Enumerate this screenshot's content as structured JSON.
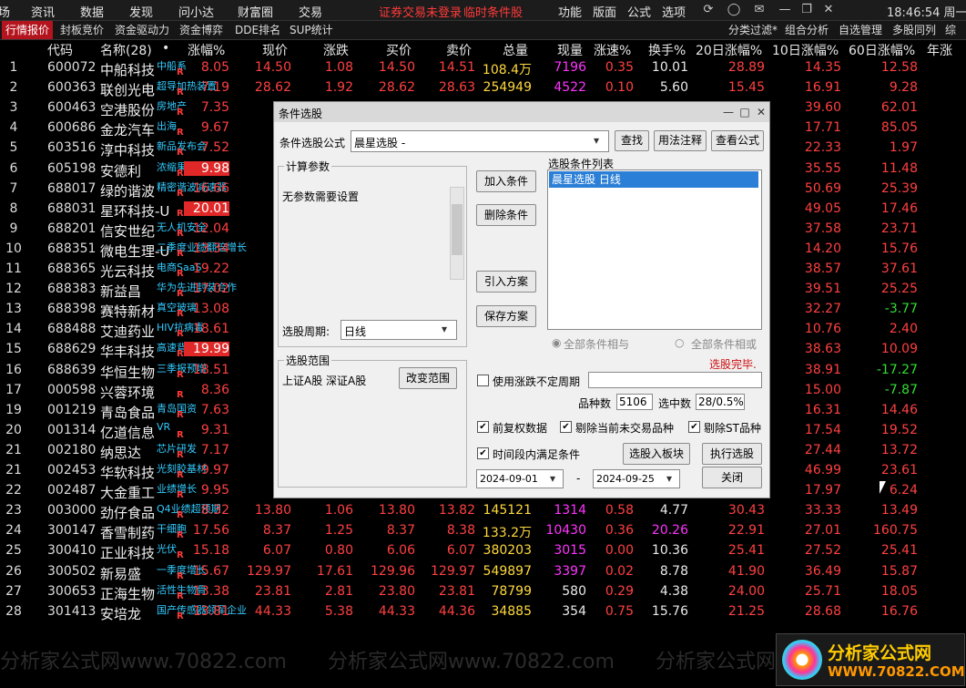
{
  "menu": {
    "items": [
      "场",
      "资讯",
      "数据",
      "发现",
      "问小达",
      "财富圈",
      "交易"
    ],
    "alert1": "证券交易未登录",
    "alert2": "临时条件股",
    "right_items": [
      "功能",
      "版面",
      "公式",
      "选项"
    ],
    "time": "18:46:54 周一"
  },
  "tabs": {
    "left": [
      "行情报价",
      "封板竞价",
      "资金驱动力",
      "资金博弈",
      "DDE排名",
      "SUP统计"
    ],
    "right": [
      "分类过滤*",
      "组合分析",
      "自选管理",
      "多股同列",
      "综"
    ]
  },
  "columns": [
    "代码",
    "名称(28)",
    "•",
    "涨幅%",
    "现价",
    "涨跌",
    "买价",
    "卖价",
    "总量",
    "现量",
    "涨速%",
    "换手%",
    "20日涨幅%",
    "10日涨幅%",
    "60日涨幅%",
    "年涨"
  ],
  "rows": [
    {
      "idx": "1",
      "code": "600072",
      "name": "中船科技",
      "tag": "中船系",
      "chg": "8.05",
      "price": "14.50",
      "diff": "1.08",
      "bid": "14.50",
      "ask": "14.51",
      "vol": "108.4万",
      "cur": "7196",
      "speed": "0.35",
      "turn": "10.01",
      "d20": "28.89",
      "d10": "14.35",
      "d60": "12.58"
    },
    {
      "idx": "2",
      "code": "600363",
      "name": "联创光电",
      "tag": "超导加热装置",
      "chg": "7.19",
      "price": "28.62",
      "diff": "1.92",
      "bid": "28.62",
      "ask": "28.63",
      "vol": "254949",
      "cur": "4522",
      "speed": "0.10",
      "turn": "5.60",
      "d20": "15.45",
      "d10": "16.91",
      "d60": "9.28"
    },
    {
      "idx": "3",
      "code": "600463",
      "name": "空港股份",
      "tag": "房地产",
      "chg": "7.35",
      "price": "12",
      "d10": "39.60",
      "d60": "62.01"
    },
    {
      "idx": "4",
      "code": "600686",
      "name": "金龙汽车",
      "tag": "出海",
      "chg": "9.67",
      "price": "13",
      "d10": "17.71",
      "d60": "85.05"
    },
    {
      "idx": "5",
      "code": "603516",
      "name": "淳中科技",
      "tag": "新品发布会",
      "chg": "7.52",
      "price": "31",
      "d10": "22.33",
      "d60": "1.97"
    },
    {
      "idx": "6",
      "code": "605198",
      "name": "安德利",
      "tag": "浓缩果汁",
      "chg": "9.98",
      "price": "23",
      "d10": "35.55",
      "d60": "11.48"
    },
    {
      "idx": "7",
      "code": "688017",
      "name": "绿的谐波",
      "tag": "精密谐波减速器",
      "chg": "16.66",
      "price": "88",
      "d10": "50.69",
      "d60": "25.39"
    },
    {
      "idx": "8",
      "code": "688031",
      "name": "星环科技-U",
      "tag": "",
      "chg": "20.01",
      "price": "39",
      "d10": "49.05",
      "d60": "17.46"
    },
    {
      "idx": "9",
      "code": "688201",
      "name": "信安世纪",
      "tag": "无人机安全",
      "chg": "12.04",
      "price": "15",
      "d10": "37.58",
      "d60": "23.71"
    },
    {
      "idx": "10",
      "code": "688351",
      "name": "微电生理-U",
      "tag": "二季度业绩翻倍增长",
      "chg": "13.34",
      "price": "21",
      "d10": "14.20",
      "d60": "15.76"
    },
    {
      "idx": "11",
      "code": "688365",
      "name": "光云科技",
      "tag": "电商SaaS",
      "chg": "19.22",
      "price": "11",
      "d10": "38.57",
      "d60": "37.61"
    },
    {
      "idx": "12",
      "code": "688383",
      "name": "新益昌",
      "tag": "华为先进封装合作",
      "chg": "17.02",
      "price": "57",
      "d10": "39.51",
      "d60": "25.25"
    },
    {
      "idx": "13",
      "code": "688398",
      "name": "赛特新材",
      "tag": "真空玻璃",
      "chg": "13.08",
      "price": "15",
      "d10": "32.27",
      "d60": "-3.77"
    },
    {
      "idx": "14",
      "code": "688488",
      "name": "艾迪药业",
      "tag": "HIV抗病毒",
      "chg": "18.61",
      "price": "9",
      "d10": "10.76",
      "d60": "2.40"
    },
    {
      "idx": "15",
      "code": "688629",
      "name": "华丰科技",
      "tag": "高速背板连接器",
      "chg": "19.99",
      "price": "27",
      "d10": "38.63",
      "d60": "10.09"
    },
    {
      "idx": "16",
      "code": "688639",
      "name": "华恒生物",
      "tag": "三季报预增",
      "chg": "18.51",
      "price": "39",
      "d10": "38.91",
      "d60": "-17.27"
    },
    {
      "idx": "17",
      "code": "000598",
      "name": "兴蓉环境",
      "tag": "",
      "chg": "8.36",
      "price": "7",
      "d10": "15.00",
      "d60": "-7.87"
    },
    {
      "idx": "19",
      "code": "001219",
      "name": "青岛食品",
      "tag": "青岛国资",
      "chg": "7.63",
      "price": "12",
      "d10": "16.31",
      "d60": "14.46"
    },
    {
      "idx": "20",
      "code": "001314",
      "name": "亿道信息",
      "tag": "VR",
      "chg": "9.31",
      "price": "42",
      "d10": "17.54",
      "d60": "19.52"
    },
    {
      "idx": "21",
      "code": "002180",
      "name": "纳思达",
      "tag": "芯片研发",
      "chg": "7.17",
      "price": "30",
      "d10": "27.44",
      "d60": "13.72"
    },
    {
      "idx": "21",
      "code": "002453",
      "name": "华软科技",
      "tag": "光刻胶基材",
      "chg": "9.97",
      "price": "10",
      "d10": "46.99",
      "d60": "23.61"
    },
    {
      "idx": "22",
      "code": "002487",
      "name": "大金重工",
      "tag": "业绩增长",
      "chg": "9.95",
      "price": "22",
      "d10": "17.97",
      "d60": "6.24"
    },
    {
      "idx": "23",
      "code": "003000",
      "name": "劲仔食品",
      "tag": "Q4业绩超预期",
      "chg": "8.32",
      "price": "13.80",
      "diff": "1.06",
      "bid": "13.80",
      "ask": "13.82",
      "vol": "145121",
      "cur": "1314",
      "speed": "0.58",
      "turn": "4.77",
      "d20": "30.43",
      "d10": "33.33",
      "d60": "13.49"
    },
    {
      "idx": "24",
      "code": "300147",
      "name": "香雪制药",
      "tag": "干细胞",
      "chg": "17.56",
      "price": "8.37",
      "diff": "1.25",
      "bid": "8.37",
      "ask": "8.38",
      "vol": "133.2万",
      "cur": "10430",
      "speed": "0.36",
      "turn": "20.26",
      "d20": "22.91",
      "d10": "27.01",
      "d60": "160.75"
    },
    {
      "idx": "25",
      "code": "300410",
      "name": "正业科技",
      "tag": "光伏",
      "chg": "15.18",
      "price": "6.07",
      "diff": "0.80",
      "bid": "6.06",
      "ask": "6.07",
      "vol": "380203",
      "cur": "3015",
      "speed": "0.00",
      "turn": "10.36",
      "d20": "25.41",
      "d10": "27.52",
      "d60": "25.41"
    },
    {
      "idx": "26",
      "code": "300502",
      "name": "新易盛",
      "tag": "一季度增长",
      "chg": "15.67",
      "price": "129.97",
      "diff": "17.61",
      "bid": "129.96",
      "ask": "129.97",
      "vol": "549897",
      "cur": "3397",
      "speed": "0.02",
      "turn": "8.78",
      "d20": "41.90",
      "d10": "36.49",
      "d60": "15.87"
    },
    {
      "idx": "27",
      "code": "300653",
      "name": "正海生物",
      "tag": "活性生物骨",
      "chg": "13.38",
      "price": "23.81",
      "diff": "2.81",
      "bid": "23.80",
      "ask": "23.81",
      "vol": "78799",
      "cur": "580",
      "speed": "0.29",
      "turn": "4.38",
      "d20": "24.00",
      "d10": "25.71",
      "d60": "18.05"
    },
    {
      "idx": "28",
      "code": "301413",
      "name": "安培龙",
      "tag": "国产传感器领军企业",
      "chg": "13.81",
      "price": "44.33",
      "diff": "5.38",
      "bid": "44.33",
      "ask": "44.36",
      "vol": "34885",
      "cur": "354",
      "speed": "0.75",
      "turn": "15.76",
      "d20": "21.25",
      "d10": "28.68",
      "d60": "16.76"
    }
  ],
  "dialog": {
    "title": "条件选股",
    "formula_label": "条件选股公式",
    "formula_value": "晨星选股  -",
    "btn_find": "查找",
    "btn_usage": "用法注释",
    "btn_view": "查看公式",
    "calc_params": "计算参数",
    "no_params": "无参数需要设置",
    "btn_add": "加入条件",
    "btn_delete": "删除条件",
    "btn_import": "引入方案",
    "btn_save": "保存方案",
    "cond_list_label": "选股条件列表",
    "cond_item": "晨星选股  日线",
    "period_label": "选股周期:",
    "period_value": "日线",
    "radio_and": "全部条件相与",
    "radio_or": "全部条件相或",
    "range_label": "选股范围",
    "range_value": "上证A股 深证A股",
    "btn_change_range": "改变范围",
    "done": "选股完毕.",
    "chk_variable": "使用涨跌不定周期",
    "count_label": "品种数",
    "count_value": "5106",
    "selected_label": "选中数",
    "selected_value": "28/0.5%",
    "chk_adjust": "前复权数据",
    "chk_remove_untraded": "剔除当前未交易品种",
    "chk_remove_st": "剔除ST品种",
    "chk_period": "时间段内满足条件",
    "btn_to_block": "选股入板块",
    "btn_execute": "执行选股",
    "date_from": "2024-09-01",
    "date_sep": "-",
    "date_to": "2024-09-25",
    "btn_close": "关闭"
  },
  "watermark": "分析家公式网www.70822.com",
  "logo": {
    "line1": "分析家公式网",
    "line2": "WWW.70822.COM"
  }
}
